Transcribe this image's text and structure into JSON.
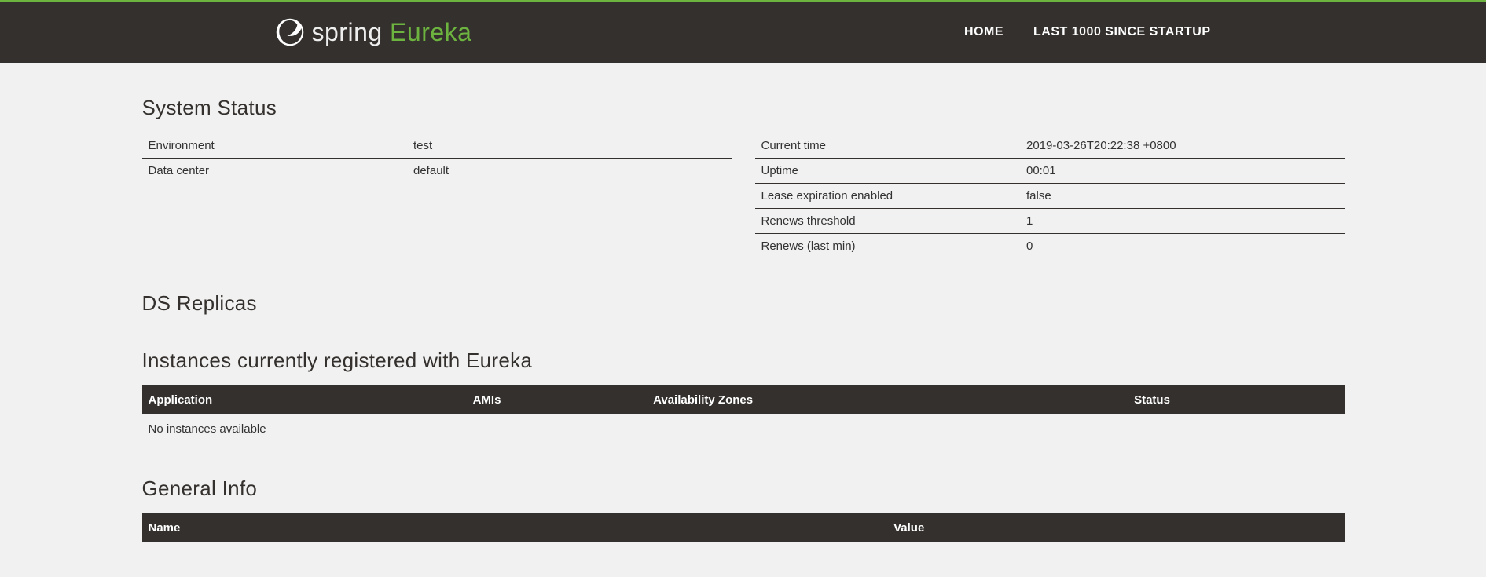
{
  "navbar": {
    "brand_spring": "spring",
    "brand_eureka": "Eureka",
    "links": {
      "home": "HOME",
      "last1000": "LAST 1000 SINCE STARTUP"
    }
  },
  "headings": {
    "system_status": "System Status",
    "ds_replicas": "DS Replicas",
    "instances": "Instances currently registered with Eureka",
    "general_info": "General Info"
  },
  "system_status_left": [
    {
      "label": "Environment",
      "value": "test"
    },
    {
      "label": "Data center",
      "value": "default"
    }
  ],
  "system_status_right": [
    {
      "label": "Current time",
      "value": "2019-03-26T20:22:38 +0800"
    },
    {
      "label": "Uptime",
      "value": "00:01"
    },
    {
      "label": "Lease expiration enabled",
      "value": "false"
    },
    {
      "label": "Renews threshold",
      "value": "1"
    },
    {
      "label": "Renews (last min)",
      "value": "0"
    }
  ],
  "instances_table": {
    "headers": {
      "application": "Application",
      "amis": "AMIs",
      "zones": "Availability Zones",
      "status": "Status"
    },
    "empty": "No instances available"
  },
  "general_info_table": {
    "headers": {
      "name": "Name",
      "value": "Value"
    }
  }
}
